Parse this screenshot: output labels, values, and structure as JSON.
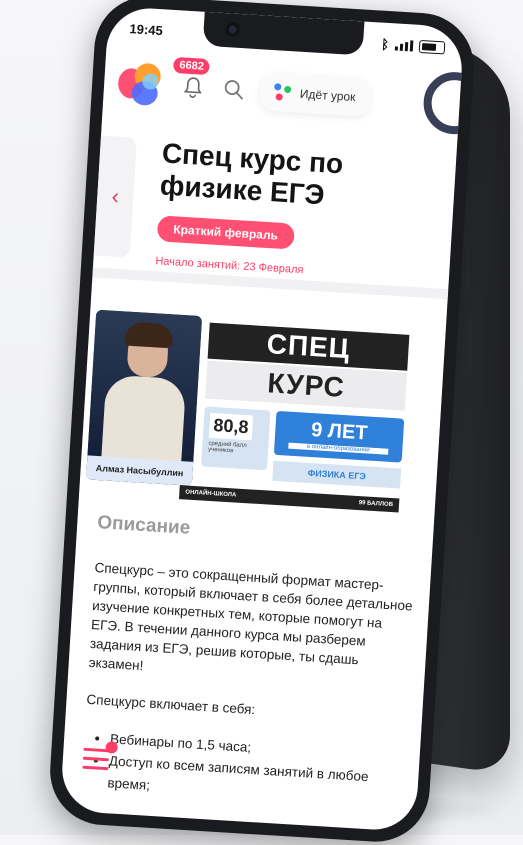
{
  "status_bar": {
    "time": "19:45"
  },
  "topbar": {
    "notification_count": "6682",
    "lesson_label": "Идёт урок"
  },
  "course": {
    "title": "Спец курс по физике ЕГЭ",
    "tag": "Краткий февраль",
    "start_date": "Начало занятий: 23 Февраля"
  },
  "banner": {
    "teacher_name": "Алмаз Насыбуллин",
    "line1": "СПЕЦ",
    "line2": "КУРС",
    "stat_score": "80,8",
    "stat_score_caption": "средний балл учеников",
    "stat_years": "9 ЛЕТ",
    "stat_years_caption": "в онлайн-образовании",
    "subject": "ФИЗИКА ЕГЭ",
    "footer_left": "ОНЛАЙН-ШКОЛА",
    "footer_right": "99 БАЛЛОВ"
  },
  "description": {
    "heading": "Описание",
    "paragraph1": "Спецкурс – это сокращенный формат мастер-группы, который включает в себя более детальное изучение конкретных тем, которые помогут на ЕГЭ. В течении данного курса мы разберем задания из ЕГЭ, решив которые, ты сдашь экзамен!",
    "paragraph2": "Спецкурс включает в себя:",
    "items": [
      "Вебинары по 1,5 часа;",
      "Доступ ко всем записям занятий в любое время;"
    ]
  },
  "colors": {
    "accent": "#ff3d68",
    "tag_bg": "#ff4f73",
    "banner_blue": "#2f80d9",
    "phone_body": "#1a1b1e"
  }
}
